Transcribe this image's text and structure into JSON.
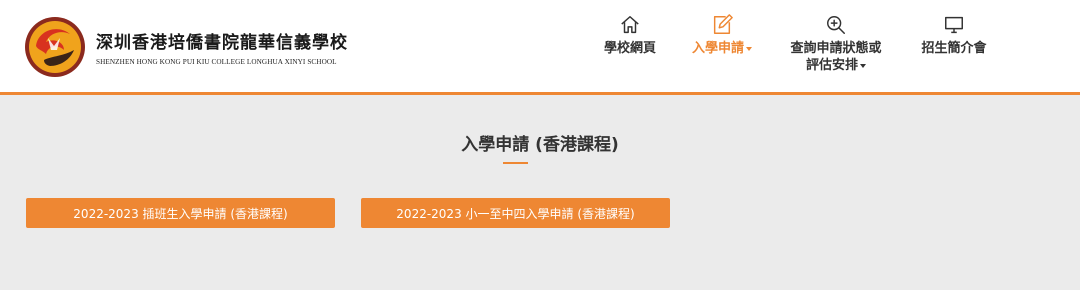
{
  "school": {
    "name_cn": "深圳香港培僑書院龍華信義學校",
    "name_en": "SHENZHEN HONG KONG PUI KIU COLLEGE LONGHUA XINYI SCHOOL"
  },
  "nav": {
    "items": [
      {
        "label": "學校網頁",
        "icon": "home-icon",
        "active": false,
        "dropdown": false
      },
      {
        "label": "入學申請",
        "icon": "edit-icon",
        "active": true,
        "dropdown": true
      },
      {
        "label_line1": "查詢申請狀態或",
        "label_line2": "評估安排",
        "icon": "search-plus-icon",
        "active": false,
        "dropdown": true
      },
      {
        "label": "招生簡介會",
        "icon": "monitor-icon",
        "active": false,
        "dropdown": false
      }
    ]
  },
  "main": {
    "title": "入學申請 (香港課程)",
    "buttons": [
      {
        "label": "2022-2023 插班生入學申請 (香港課程)"
      },
      {
        "label": "2022-2023 小一至中四入學申請 (香港課程)"
      }
    ]
  },
  "colors": {
    "accent": "#ee8733",
    "background": "#ebebeb",
    "header": "#ffffff",
    "text": "#333333"
  }
}
